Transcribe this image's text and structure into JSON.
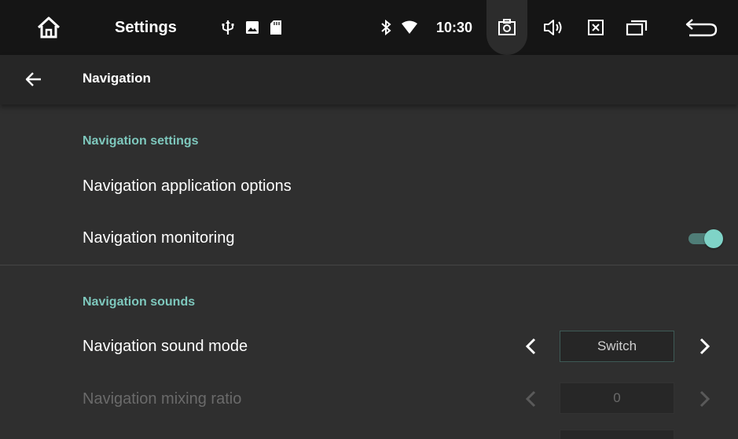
{
  "statusbar": {
    "app_title": "Settings",
    "time": "10:30",
    "icons": [
      "home-icon",
      "usb-icon",
      "image-icon",
      "sd-card-icon",
      "bluetooth-icon",
      "wifi-icon",
      "screenshot-icon",
      "volume-icon",
      "close-box-icon",
      "recent-apps-icon",
      "back-return-icon"
    ]
  },
  "toolbar": {
    "title": "Navigation"
  },
  "sections": {
    "settings": {
      "header": "Navigation settings",
      "app_options": "Navigation application options",
      "monitoring": "Navigation monitoring",
      "monitoring_enabled": true
    },
    "sounds": {
      "header": "Navigation sounds",
      "sound_mode": {
        "label": "Navigation sound mode",
        "value": "Switch"
      },
      "mixing_ratio": {
        "label": "Navigation mixing ratio",
        "value": "0",
        "enabled": false
      }
    }
  },
  "colors": {
    "accent": "#7ec8bd",
    "toggle_thumb": "#7fd3c7",
    "background": "#2f2f2f",
    "statusbar": "#151515"
  }
}
